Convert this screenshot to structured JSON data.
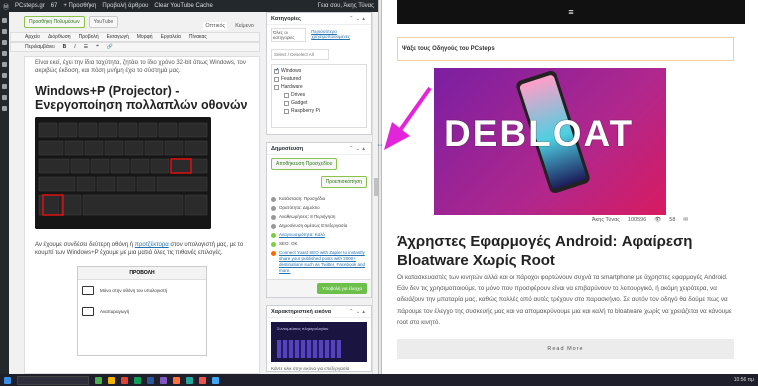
{
  "admin_bar": {
    "site": "PCsteps.gr",
    "comments": "67",
    "new": "+ Προσθήκη",
    "preview": "Προβολή άρθρου",
    "cache": "Clear YouTube Cache",
    "user": "Γεια σου, Άκης Τύνας"
  },
  "editor": {
    "add_media": "Προσθήκη Πολυμέσων",
    "youtube": "YouTube",
    "tab_visual": "Οπτικός",
    "tab_text": "Κείμενο",
    "toolbar_row1": [
      "Αρχείο",
      "Διόρθωση",
      "Προβολή",
      "Εισαγωγή",
      "Μορφή",
      "Εργαλεία",
      "Πίνακας"
    ],
    "toolbar_row2": "Περιλαμβάνει",
    "intro": "Είναι εκεί, έχει την ίδια ταχύτητα, ζητάει το ίδιο χρόνο 32-bit όπως Windows, τον ακριβώς έκδοση, και πόση μνήμη έχει το σύστημά μας.",
    "heading": "Windows+P (Projector) - Ενεργοποίηση πολλαπλών οθονών",
    "para_start": "Αν έχουμε συνδέσει δεύτερη οθόνη ή ",
    "para_link": "προτζέκτορα",
    "para_end": " στον υπολογιστή μας, με το κουμπί των Windows+P έχουμε με μια ματιά όλες τις πιθανές επιλογές.",
    "proj_title": "ΠΡΟΒΟΛΗ",
    "proj_opt1": "Μόνο στην οθόνη του υπολογιστή",
    "proj_opt2": "Αναπαραγωγή"
  },
  "sidebar": {
    "categories_title": "Κατηγορίες",
    "cat_tab_all": "Όλες οι κατηγορίες",
    "cat_tab_popular": "Περισσότερο χρησιμοποιούμενες",
    "select_deselect": "Select / Deselect All",
    "categories": [
      {
        "label": "Windows",
        "checked": true,
        "indent": false
      },
      {
        "label": "Featured",
        "checked": false,
        "indent": false
      },
      {
        "label": "Hardware",
        "checked": false,
        "indent": false
      },
      {
        "label": "Drives",
        "checked": false,
        "indent": true
      },
      {
        "label": "Gadget",
        "checked": false,
        "indent": true
      },
      {
        "label": "Raspberry Pi",
        "checked": false,
        "indent": true
      }
    ],
    "publish_title": "Δημοσίευση",
    "save_draft": "Αποθήκευση Προσχεδίου",
    "preview": "Προεπισκόπηση",
    "status": "Κατάσταση: Προσχέδιο",
    "visibility": "Ορατότητα: Δημόσιο",
    "revisions": "Αναθεωρήσεις: 8 Περιήγηση",
    "publish_immediately": "Δημοσίευση αμέσως Επεξεργασία",
    "readability": "Αναγνωσιμότητα: Καλό",
    "seo": "SEO: OK",
    "zapier": "Connect Yoast SEO with Zapier to instantly share your published posts with 2000+ destinations such as Twitter, Facebook and more.",
    "publish_button": "Υποβολή για έλεγχο",
    "featured_title": "Χαρακτηριστική εικόνα",
    "featured_caption": "Κάντε κλικ στην εικόνα για επεξεργασία",
    "featured_img_text": "Συντομεύσεις πληκτρολογίου"
  },
  "site": {
    "guides_label": "Ψάξε τους Οδηγούς του PCsteps",
    "hero_word": "DEBLOAT",
    "author": "Άκης Τύνας",
    "views": "100596",
    "comments": "58",
    "title": "Άχρηστες Εφαρμογές Android: Αφαίρεση Bloatware Χωρίς Root",
    "excerpt": "Οι κατασκευαστές των κινητών αλλά και οι πάροχοι φορτώνουν συχνά τα smartphone με άχρηστες εφαρμογές Android. Εάν δεν τις χρησιμοποιούμε, το μόνο που προσφέρουν είναι να επιβαρύνουν το λειτουργικό, ή ακόμη χειρότερα, να αδειάζουν την μπαταρία μας, καθώς πολλές από αυτές τρέχουν στο παρασκήνιο. Σε αυτόν τον οδηγό θα δούμε πως να πάρουμε τον έλεγχο της συσκευής μας και να απομακρύνουμε μια και καλή το bloatware χωρίς να χρειάζεται να κάνουμε root στο κινητό.",
    "read_more": "Read More"
  },
  "taskbar": {
    "tray": "10:56 πμ"
  },
  "colors": {
    "accent_arrow": "#e225d8",
    "admin_bar": "#23282d",
    "link": "#2271b1",
    "publish": "#6cc04a"
  }
}
